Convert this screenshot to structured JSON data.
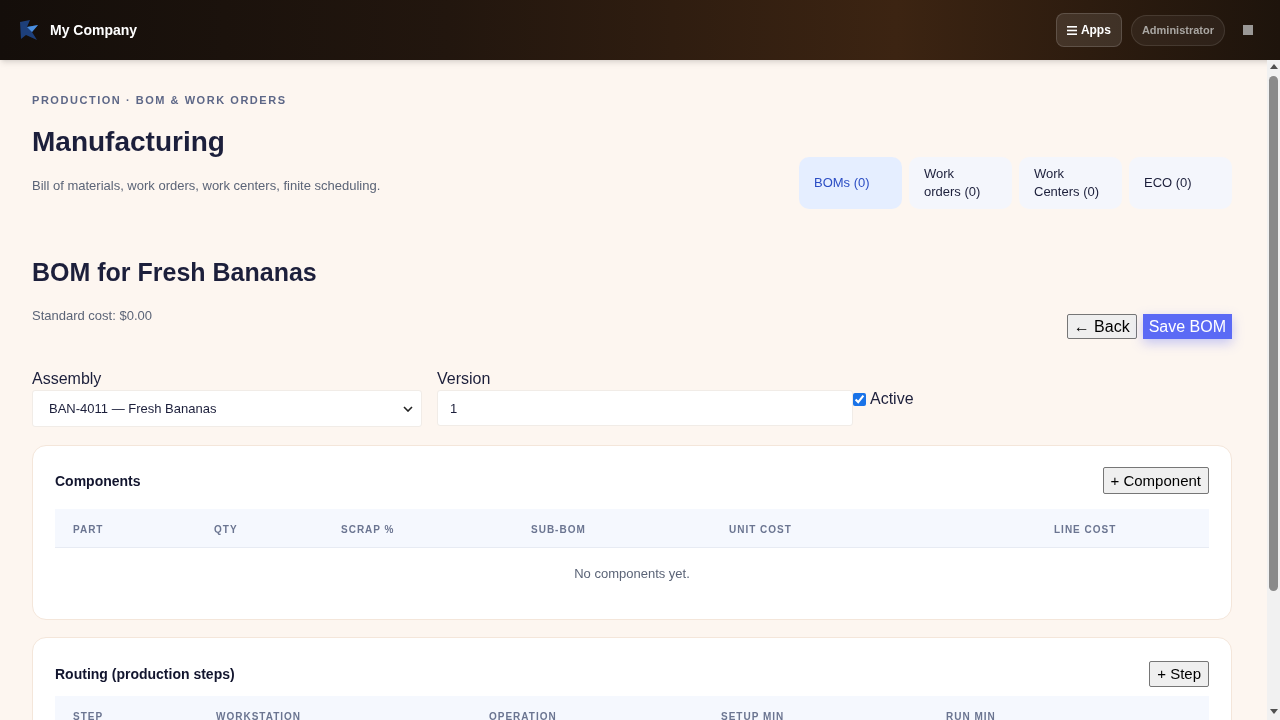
{
  "header": {
    "brand": "My Company",
    "apps_button": "Apps",
    "user": "Administrator"
  },
  "page": {
    "breadcrumb": "PRODUCTION · BOM & WORK ORDERS",
    "title": "Manufacturing",
    "subtitle": "Bill of materials, work orders, work centers, finite scheduling."
  },
  "tabs": [
    {
      "label": "BOMs (0)",
      "selected": true
    },
    {
      "label": "Work orders (0)",
      "selected": false
    },
    {
      "label": "Work Centers (0)",
      "selected": false
    },
    {
      "label": "ECO (0)",
      "selected": false
    }
  ],
  "bom": {
    "title": "BOM for Fresh Bananas",
    "standard_cost": "Standard cost: $0.00",
    "back_button": "← Back",
    "save_button": "Save BOM"
  },
  "form": {
    "fields": [
      {
        "kind": "select",
        "label": "Assembly",
        "value": "BAN-4011 — Fresh Bananas"
      },
      {
        "kind": "input",
        "label": "Version",
        "value": "1"
      }
    ],
    "active": {
      "label": "Active",
      "checked": true
    }
  },
  "sections": [
    {
      "title": "Components",
      "add_button": "+ Component",
      "columns": [
        "PART",
        "QTY",
        "SCRAP %",
        "SUB-BOM",
        "UNIT COST",
        "LINE COST"
      ],
      "empty_text": "No components yet."
    },
    {
      "title": "Routing (production steps)",
      "add_button": "+ Step",
      "columns": [
        "STEP",
        "WORKSTATION",
        "OPERATION",
        "SETUP MIN",
        "RUN MIN"
      ]
    }
  ]
}
